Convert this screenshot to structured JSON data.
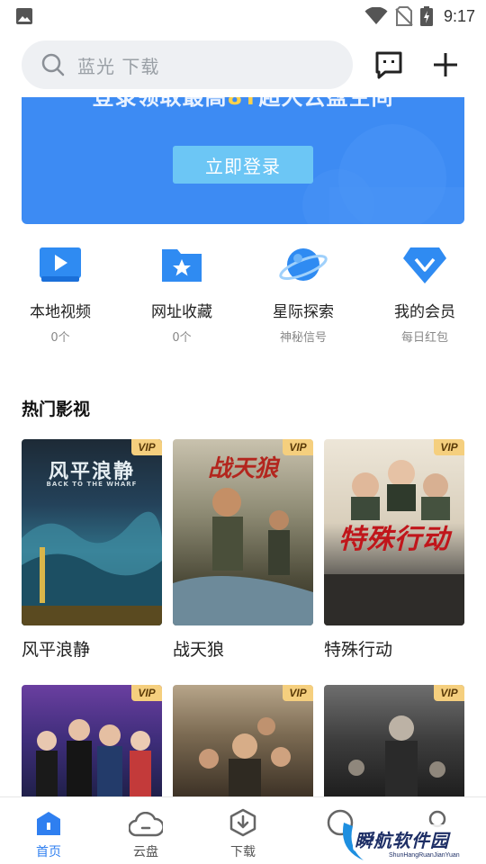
{
  "status_bar": {
    "time": "9:17"
  },
  "search": {
    "placeholder": "蓝光 下载"
  },
  "banner": {
    "slogan_before": "登录领取最高",
    "slogan_accent": "8T",
    "slogan_after": "超大云盘空间",
    "login_label": "立即登录"
  },
  "entries": [
    {
      "label": "本地视频",
      "sub": "0个"
    },
    {
      "label": "网址收藏",
      "sub": "0个"
    },
    {
      "label": "星际探索",
      "sub": "神秘信号"
    },
    {
      "label": "我的会员",
      "sub": "每日红包"
    }
  ],
  "hot": {
    "title": "热门影视",
    "vip_badge": "VIP",
    "items": [
      {
        "title": "风平浪静",
        "poster_text": "风平浪静",
        "poster_sub": "BACK TO THE WHARF"
      },
      {
        "title": "战天狼",
        "poster_text": "战天狼",
        "poster_sub": ""
      },
      {
        "title": "特殊行动",
        "poster_text": "特殊行动",
        "poster_sub": ""
      },
      {
        "title": "",
        "poster_text": "",
        "poster_sub": ""
      },
      {
        "title": "",
        "poster_text": "",
        "poster_sub": ""
      },
      {
        "title": "",
        "poster_text": "",
        "poster_sub": ""
      }
    ]
  },
  "nav": [
    {
      "label": "首页"
    },
    {
      "label": "云盘"
    },
    {
      "label": "下载"
    }
  ],
  "watermark": {
    "text": "瞬航软件园",
    "sub": "ShunHangRuanJianYuan"
  },
  "colors": {
    "accent": "#2f7ff0",
    "banner": "#3d8bf3",
    "vip": "#f5cf7e"
  }
}
